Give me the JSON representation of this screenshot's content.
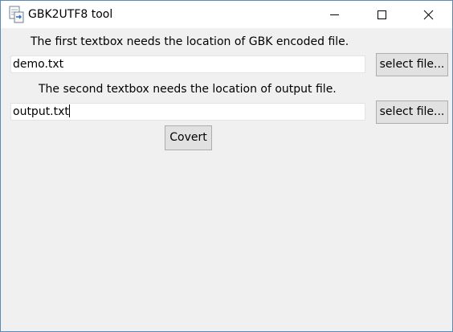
{
  "window": {
    "title": "GBK2UTF8 tool",
    "icon": "notepad-convert-icon",
    "controls": [
      "minimize-icon",
      "maximize-icon",
      "close-icon"
    ]
  },
  "form": {
    "label_input": "The first textbox needs the location of GBK encoded file.",
    "input_value": "demo.txt",
    "select_input_label": "select file...",
    "label_output": "The second textbox needs the location of output file.",
    "output_value": "output.txt",
    "select_output_label": "select file...",
    "convert_label": "Covert"
  },
  "colors": {
    "window_bg": "#f0f0f0",
    "titlebar_bg": "#ffffff",
    "button_bg": "#e1e1e1",
    "button_border": "#adadad",
    "window_border": "#5a8ab6"
  }
}
